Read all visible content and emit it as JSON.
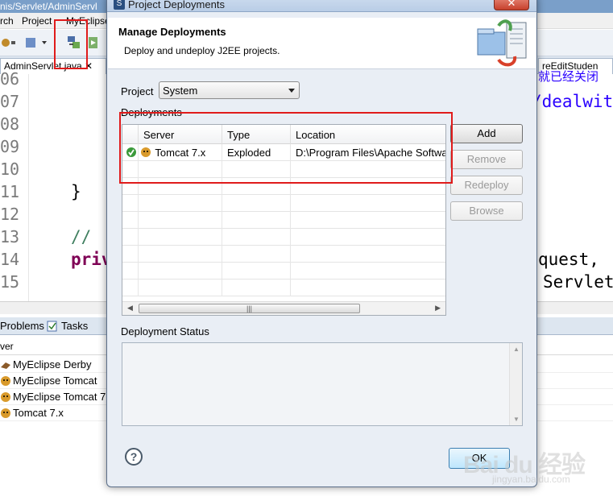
{
  "background": {
    "title_fragment": "nis/Servlet/AdminServl",
    "menu": [
      "rch",
      "Project",
      "MyEclipse"
    ],
    "editor_tabs": [
      "AdminServlet.java",
      "reEditStuden"
    ],
    "line_numbers": [
      "06",
      "07",
      "08",
      "09",
      "10",
      "11",
      "12",
      "13",
      "14",
      "15"
    ],
    "code_lines": {
      "brace": "}",
      "comment": "//",
      "private_kw": "priv",
      "right_frag_1": "/dealwit",
      "right_frag_2": "quest,",
      "right_frag_3": "Servlet",
      "cjk_frag": "就已经关闭"
    },
    "views": [
      "Problems",
      "Tasks"
    ],
    "servers_col_header": "ver",
    "servers": [
      "MyEclipse Derby",
      "MyEclipse Tomcat",
      "MyEclipse Tomcat 7",
      "Tomcat  7.x"
    ]
  },
  "dialog": {
    "title": "Project Deployments",
    "heading": "Manage Deployments",
    "subheading": "Deploy and undeploy J2EE projects.",
    "project_label": "Project",
    "project_value": "System",
    "deployments_label": "Deployments",
    "columns": [
      "Server",
      "Type",
      "Location"
    ],
    "rows": [
      {
        "server": "Tomcat  7.x",
        "type": "Exploded",
        "location": "D:\\Program Files\\Apache Softwa"
      }
    ],
    "buttons": {
      "add": "Add",
      "remove": "Remove",
      "redeploy": "Redeploy",
      "browse": "Browse",
      "ok": "OK"
    },
    "status_label": "Deployment Status",
    "help": "?"
  },
  "watermark": {
    "brand": "Bai du 经验",
    "sub": "jingyan.baidu.com"
  },
  "colors": {
    "highlight_red": "#e01b1b",
    "dialog_bg": "#e9eef5",
    "titlebar": "#b9cde6"
  }
}
